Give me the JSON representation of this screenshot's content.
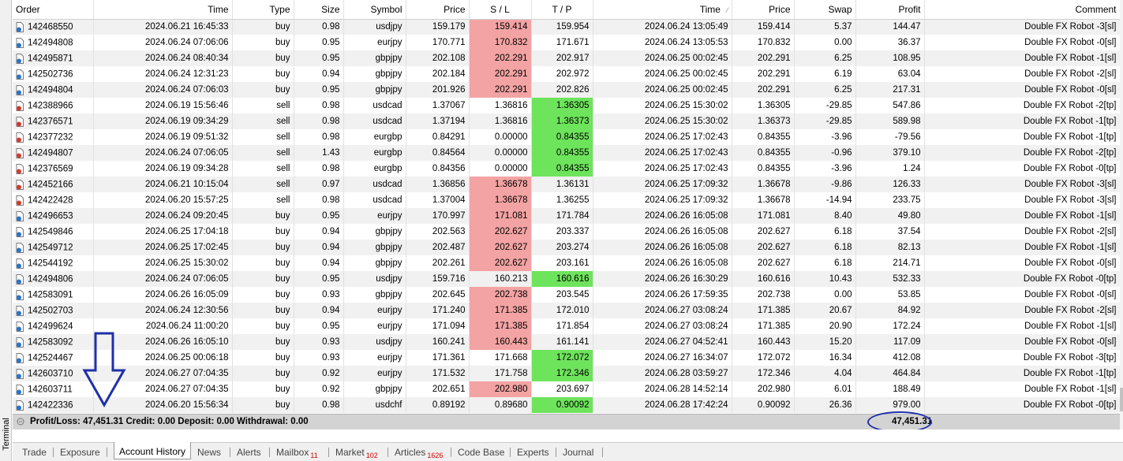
{
  "window": {
    "panel_label": "Terminal"
  },
  "columns": [
    "Order",
    "Time",
    "Type",
    "Size",
    "Symbol",
    "Price",
    "S / L",
    "T / P",
    "Time",
    "Price",
    "Swap",
    "Profit",
    "Comment"
  ],
  "rows": [
    {
      "order": "142468550",
      "open_time": "2024.06.21 16:45:33",
      "type": "buy",
      "size": "0.98",
      "symbol": "usdjpy",
      "price": "159.179",
      "sl": "159.414",
      "tp": "159.954",
      "close_time": "2024.06.24 13:05:49",
      "close_price": "159.414",
      "swap": "5.37",
      "profit": "144.47",
      "comment": "Double FX Robot -3[sl]",
      "hit": "sl",
      "icon": "blue"
    },
    {
      "order": "142494808",
      "open_time": "2024.06.24 07:06:06",
      "type": "buy",
      "size": "0.95",
      "symbol": "eurjpy",
      "price": "170.771",
      "sl": "170.832",
      "tp": "171.671",
      "close_time": "2024.06.24 13:05:53",
      "close_price": "170.832",
      "swap": "0.00",
      "profit": "36.37",
      "comment": "Double FX Robot -0[sl]",
      "hit": "sl",
      "icon": "blue"
    },
    {
      "order": "142495871",
      "open_time": "2024.06.24 08:40:34",
      "type": "buy",
      "size": "0.95",
      "symbol": "gbpjpy",
      "price": "202.108",
      "sl": "202.291",
      "tp": "202.917",
      "close_time": "2024.06.25 00:02:45",
      "close_price": "202.291",
      "swap": "6.25",
      "profit": "108.95",
      "comment": "Double FX Robot -1[sl]",
      "hit": "sl",
      "icon": "blue"
    },
    {
      "order": "142502736",
      "open_time": "2024.06.24 12:31:23",
      "type": "buy",
      "size": "0.94",
      "symbol": "gbpjpy",
      "price": "202.184",
      "sl": "202.291",
      "tp": "202.972",
      "close_time": "2024.06.25 00:02:45",
      "close_price": "202.291",
      "swap": "6.19",
      "profit": "63.04",
      "comment": "Double FX Robot -2[sl]",
      "hit": "sl",
      "icon": "blue"
    },
    {
      "order": "142494804",
      "open_time": "2024.06.24 07:06:03",
      "type": "buy",
      "size": "0.95",
      "symbol": "gbpjpy",
      "price": "201.926",
      "sl": "202.291",
      "tp": "202.826",
      "close_time": "2024.06.25 00:02:45",
      "close_price": "202.291",
      "swap": "6.25",
      "profit": "217.31",
      "comment": "Double FX Robot -0[sl]",
      "hit": "sl",
      "icon": "blue"
    },
    {
      "order": "142388966",
      "open_time": "2024.06.19 15:56:46",
      "type": "sell",
      "size": "0.98",
      "symbol": "usdcad",
      "price": "1.37067",
      "sl": "1.36816",
      "tp": "1.36305",
      "close_time": "2024.06.25 15:30:02",
      "close_price": "1.36305",
      "swap": "-29.85",
      "profit": "547.86",
      "comment": "Double FX Robot -2[tp]",
      "hit": "tp",
      "icon": "red"
    },
    {
      "order": "142376571",
      "open_time": "2024.06.19 09:34:29",
      "type": "sell",
      "size": "0.98",
      "symbol": "usdcad",
      "price": "1.37194",
      "sl": "1.36816",
      "tp": "1.36373",
      "close_time": "2024.06.25 15:30:02",
      "close_price": "1.36373",
      "swap": "-29.85",
      "profit": "589.98",
      "comment": "Double FX Robot -1[tp]",
      "hit": "tp",
      "icon": "red"
    },
    {
      "order": "142377232",
      "open_time": "2024.06.19 09:51:32",
      "type": "sell",
      "size": "0.98",
      "symbol": "eurgbp",
      "price": "0.84291",
      "sl": "0.00000",
      "tp": "0.84355",
      "close_time": "2024.06.25 17:02:43",
      "close_price": "0.84355",
      "swap": "-3.96",
      "profit": "-79.56",
      "comment": "Double FX Robot -1[tp]",
      "hit": "tp",
      "icon": "red"
    },
    {
      "order": "142494807",
      "open_time": "2024.06.24 07:06:05",
      "type": "sell",
      "size": "1.43",
      "symbol": "eurgbp",
      "price": "0.84564",
      "sl": "0.00000",
      "tp": "0.84355",
      "close_time": "2024.06.25 17:02:43",
      "close_price": "0.84355",
      "swap": "-0.96",
      "profit": "379.10",
      "comment": "Double FX Robot -2[tp]",
      "hit": "tp",
      "icon": "red"
    },
    {
      "order": "142376569",
      "open_time": "2024.06.19 09:34:28",
      "type": "sell",
      "size": "0.98",
      "symbol": "eurgbp",
      "price": "0.84356",
      "sl": "0.00000",
      "tp": "0.84355",
      "close_time": "2024.06.25 17:02:43",
      "close_price": "0.84355",
      "swap": "-3.96",
      "profit": "1.24",
      "comment": "Double FX Robot -0[tp]",
      "hit": "tp",
      "icon": "red"
    },
    {
      "order": "142452166",
      "open_time": "2024.06.21 10:15:04",
      "type": "sell",
      "size": "0.97",
      "symbol": "usdcad",
      "price": "1.36856",
      "sl": "1.36678",
      "tp": "1.36131",
      "close_time": "2024.06.25 17:09:32",
      "close_price": "1.36678",
      "swap": "-9.86",
      "profit": "126.33",
      "comment": "Double FX Robot -3[sl]",
      "hit": "sl",
      "icon": "red"
    },
    {
      "order": "142422428",
      "open_time": "2024.06.20 15:57:25",
      "type": "sell",
      "size": "0.98",
      "symbol": "usdcad",
      "price": "1.37004",
      "sl": "1.36678",
      "tp": "1.36255",
      "close_time": "2024.06.25 17:09:32",
      "close_price": "1.36678",
      "swap": "-14.94",
      "profit": "233.75",
      "comment": "Double FX Robot -3[sl]",
      "hit": "sl",
      "icon": "red"
    },
    {
      "order": "142496653",
      "open_time": "2024.06.24 09:20:45",
      "type": "buy",
      "size": "0.95",
      "symbol": "eurjpy",
      "price": "170.997",
      "sl": "171.081",
      "tp": "171.784",
      "close_time": "2024.06.26 16:05:08",
      "close_price": "171.081",
      "swap": "8.40",
      "profit": "49.80",
      "comment": "Double FX Robot -1[sl]",
      "hit": "sl",
      "icon": "blue"
    },
    {
      "order": "142549846",
      "open_time": "2024.06.25 17:04:18",
      "type": "buy",
      "size": "0.94",
      "symbol": "gbpjpy",
      "price": "202.563",
      "sl": "202.627",
      "tp": "203.337",
      "close_time": "2024.06.26 16:05:08",
      "close_price": "202.627",
      "swap": "6.18",
      "profit": "37.54",
      "comment": "Double FX Robot -2[sl]",
      "hit": "sl",
      "icon": "blue"
    },
    {
      "order": "142549712",
      "open_time": "2024.06.25 17:02:45",
      "type": "buy",
      "size": "0.94",
      "symbol": "gbpjpy",
      "price": "202.487",
      "sl": "202.627",
      "tp": "203.274",
      "close_time": "2024.06.26 16:05:08",
      "close_price": "202.627",
      "swap": "6.18",
      "profit": "82.13",
      "comment": "Double FX Robot -1[sl]",
      "hit": "sl",
      "icon": "blue"
    },
    {
      "order": "142544192",
      "open_time": "2024.06.25 15:30:02",
      "type": "buy",
      "size": "0.94",
      "symbol": "gbpjpy",
      "price": "202.261",
      "sl": "202.627",
      "tp": "203.161",
      "close_time": "2024.06.26 16:05:08",
      "close_price": "202.627",
      "swap": "6.18",
      "profit": "214.71",
      "comment": "Double FX Robot -0[sl]",
      "hit": "sl",
      "icon": "blue"
    },
    {
      "order": "142494806",
      "open_time": "2024.06.24 07:06:05",
      "type": "buy",
      "size": "0.95",
      "symbol": "usdjpy",
      "price": "159.716",
      "sl": "160.213",
      "tp": "160.616",
      "close_time": "2024.06.26 16:30:29",
      "close_price": "160.616",
      "swap": "10.43",
      "profit": "532.33",
      "comment": "Double FX Robot -0[tp]",
      "hit": "tp",
      "icon": "blue"
    },
    {
      "order": "142583091",
      "open_time": "2024.06.26 16:05:09",
      "type": "buy",
      "size": "0.93",
      "symbol": "gbpjpy",
      "price": "202.645",
      "sl": "202.738",
      "tp": "203.545",
      "close_time": "2024.06.26 17:59:35",
      "close_price": "202.738",
      "swap": "0.00",
      "profit": "53.85",
      "comment": "Double FX Robot -0[sl]",
      "hit": "sl",
      "icon": "blue"
    },
    {
      "order": "142502703",
      "open_time": "2024.06.24 12:30:56",
      "type": "buy",
      "size": "0.94",
      "symbol": "eurjpy",
      "price": "171.240",
      "sl": "171.385",
      "tp": "172.010",
      "close_time": "2024.06.27 03:08:24",
      "close_price": "171.385",
      "swap": "20.67",
      "profit": "84.92",
      "comment": "Double FX Robot -2[sl]",
      "hit": "sl",
      "icon": "blue"
    },
    {
      "order": "142499624",
      "open_time": "2024.06.24 11:00:20",
      "type": "buy",
      "size": "0.95",
      "symbol": "eurjpy",
      "price": "171.094",
      "sl": "171.385",
      "tp": "171.854",
      "close_time": "2024.06.27 03:08:24",
      "close_price": "171.385",
      "swap": "20.90",
      "profit": "172.24",
      "comment": "Double FX Robot -1[sl]",
      "hit": "sl",
      "icon": "blue"
    },
    {
      "order": "142583092",
      "open_time": "2024.06.26 16:05:10",
      "type": "buy",
      "size": "0.93",
      "symbol": "usdjpy",
      "price": "160.241",
      "sl": "160.443",
      "tp": "161.141",
      "close_time": "2024.06.27 04:52:41",
      "close_price": "160.443",
      "swap": "15.20",
      "profit": "117.09",
      "comment": "Double FX Robot -0[sl]",
      "hit": "sl",
      "icon": "blue"
    },
    {
      "order": "142524467",
      "open_time": "2024.06.25 00:06:18",
      "type": "buy",
      "size": "0.93",
      "symbol": "eurjpy",
      "price": "171.361",
      "sl": "171.668",
      "tp": "172.072",
      "close_time": "2024.06.27 16:34:07",
      "close_price": "172.072",
      "swap": "16.34",
      "profit": "412.08",
      "comment": "Double FX Robot -3[tp]",
      "hit": "tp",
      "icon": "blue"
    },
    {
      "order": "142603710",
      "open_time": "2024.06.27 07:04:35",
      "type": "buy",
      "size": "0.92",
      "symbol": "eurjpy",
      "price": "171.532",
      "sl": "171.758",
      "tp": "172.346",
      "close_time": "2024.06.28 03:59:27",
      "close_price": "172.346",
      "swap": "4.04",
      "profit": "464.84",
      "comment": "Double FX Robot -1[tp]",
      "hit": "tp",
      "icon": "blue"
    },
    {
      "order": "142603711",
      "open_time": "2024.06.27 07:04:35",
      "type": "buy",
      "size": "0.92",
      "symbol": "gbpjpy",
      "price": "202.651",
      "sl": "202.980",
      "tp": "203.697",
      "close_time": "2024.06.28 14:52:14",
      "close_price": "202.980",
      "swap": "6.01",
      "profit": "188.49",
      "comment": "Double FX Robot -1[sl]",
      "hit": "sl",
      "icon": "blue"
    },
    {
      "order": "142422336",
      "open_time": "2024.06.20 15:56:34",
      "type": "buy",
      "size": "0.98",
      "symbol": "usdchf",
      "price": "0.89192",
      "sl": "0.89680",
      "tp": "0.90092",
      "close_time": "2024.06.28 17:42:24",
      "close_price": "0.90092",
      "swap": "26.36",
      "profit": "979.00",
      "comment": "Double FX Robot -0[tp]",
      "hit": "tp",
      "icon": "blue"
    }
  ],
  "summary": {
    "text": "Profit/Loss: 47,451.31  Credit: 0.00  Deposit: 0.00  Withdrawal: 0.00",
    "total": "47,451.31"
  },
  "tabs": [
    {
      "label": "Trade",
      "count": ""
    },
    {
      "label": "Exposure",
      "count": ""
    },
    {
      "label": "Account History",
      "count": "",
      "active": true
    },
    {
      "label": "News",
      "count": ""
    },
    {
      "label": "Alerts",
      "count": ""
    },
    {
      "label": "Mailbox",
      "count": "11"
    },
    {
      "label": "Market",
      "count": "102"
    },
    {
      "label": "Articles",
      "count": "1626"
    },
    {
      "label": "Code Base",
      "count": ""
    },
    {
      "label": "Experts",
      "count": ""
    },
    {
      "label": "Journal",
      "count": ""
    }
  ],
  "colors": {
    "sl_highlight": "#f3a3a3",
    "tp_highlight": "#6ee35c",
    "annotation": "#1f2fa8",
    "icon_buy": "#2a73c9",
    "icon_sell": "#d33a2c"
  }
}
